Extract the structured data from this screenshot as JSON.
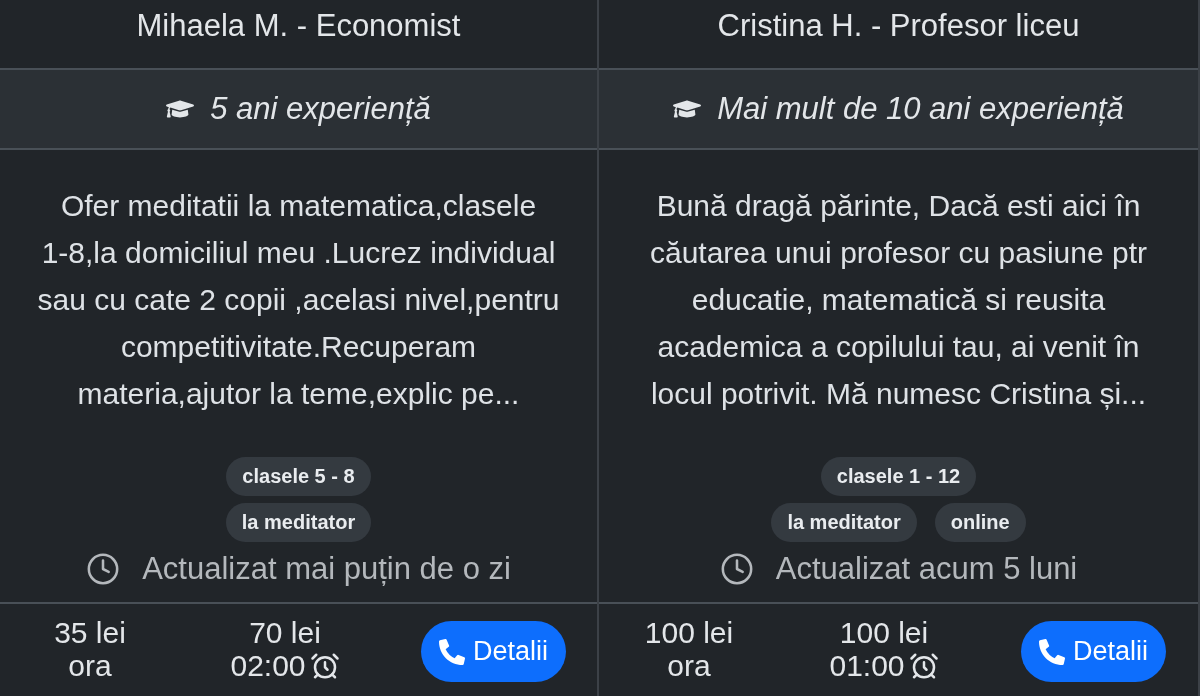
{
  "cards": [
    {
      "title": "Mihaela M. - Economist",
      "experience": "5 ani experiență",
      "description": "Ofer meditatii la matematica,clasele 1-8,la domiciliul meu .Lucrez individual sau cu cate 2 copii ,acelasi nivel,pentru competitivitate.Recuperam materia,ajutor la teme,explic pe...",
      "tag_rows": [
        [
          "clasele 5 - 8"
        ],
        [
          "la meditator"
        ]
      ],
      "updated": "Actualizat mai puțin de o zi",
      "hourly_price": {
        "amount": "35 lei",
        "unit": "ora"
      },
      "session_price": {
        "amount": "70 lei",
        "duration": "02:00"
      },
      "button": "Detalii"
    },
    {
      "title": "Cristina H. - Profesor liceu",
      "experience": "Mai mult de 10 ani experiență",
      "description": "Bună dragă părinte, Dacă esti aici în căutarea unui profesor cu pasiune ptr educatie, matematică si reusita academica a copilului tau, ai venit în locul potrivit. Mă numesc Cristina și...",
      "tag_rows": [
        [
          "clasele 1 - 12"
        ],
        [
          "la meditator",
          "online"
        ]
      ],
      "updated": "Actualizat acum 5 luni",
      "hourly_price": {
        "amount": "100 lei",
        "unit": "ora"
      },
      "session_price": {
        "amount": "100 lei",
        "duration": "01:00"
      },
      "button": "Detalii"
    }
  ]
}
